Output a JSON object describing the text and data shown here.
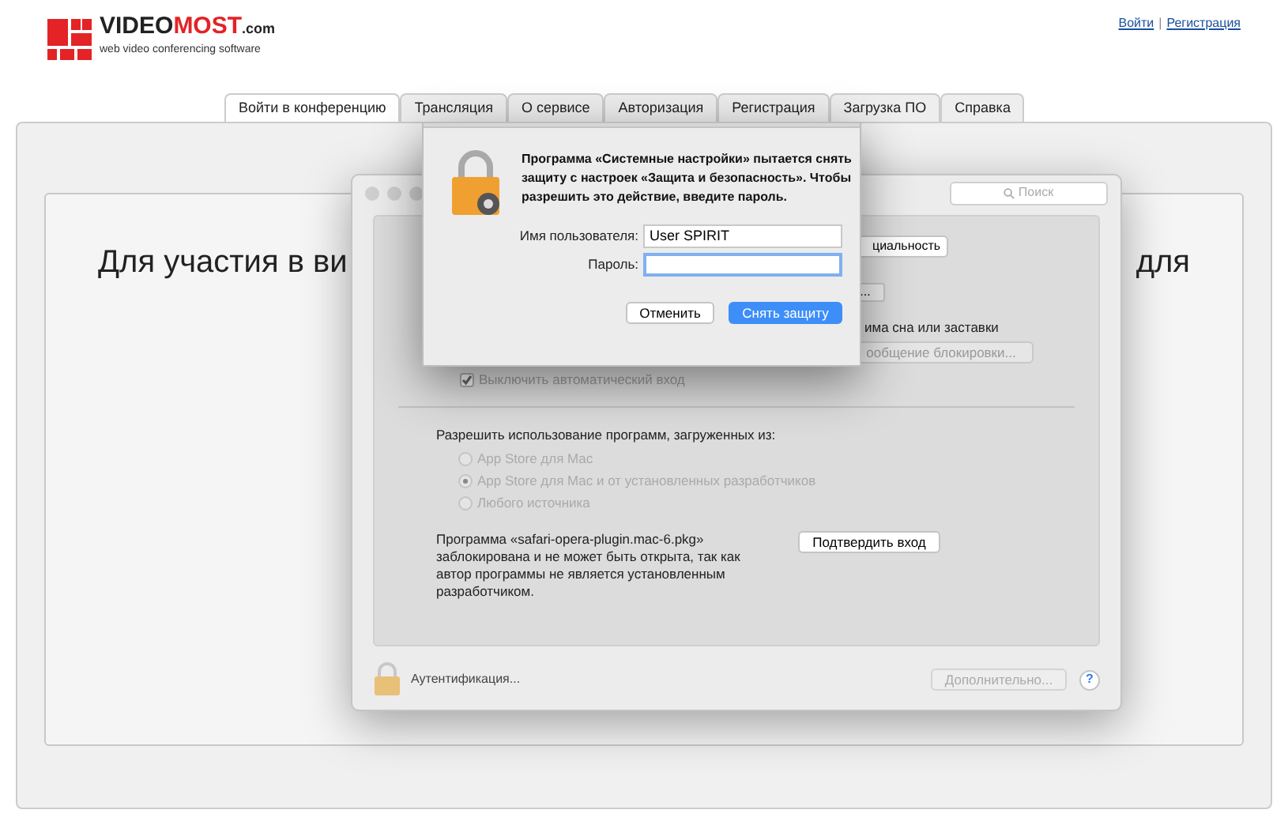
{
  "header": {
    "logo": {
      "brand_first": "VIDEO",
      "brand_second": "MOST",
      "brand_suffix": ".com",
      "tagline": "web video conferencing software"
    },
    "links": [
      "Войти",
      "Регистрация"
    ],
    "separator": "|"
  },
  "tabs": [
    {
      "label": "Войти в конференцию",
      "selected": true
    },
    {
      "label": "Трансляция",
      "selected": false
    },
    {
      "label": "О сервисе",
      "selected": false
    },
    {
      "label": "Авторизация",
      "selected": false
    },
    {
      "label": "Регистрация",
      "selected": false
    },
    {
      "label": "Загрузка ПО",
      "selected": false
    },
    {
      "label": "Справка",
      "selected": false
    }
  ],
  "page": {
    "heading_left": "Для участия в ви",
    "heading_right": "для"
  },
  "settings_window": {
    "search_placeholder": "Поиск",
    "partial_tab_button": "циальность",
    "partial_small_button": "...",
    "partial_label": "има сна или заставки",
    "partial_message_button": "ообщение блокировки...",
    "auto_login": {
      "label": "Выключить автоматический вход",
      "checked": true,
      "disabled": true
    },
    "allow_label": "Разрешить использование программ, загруженных из:",
    "sources": [
      {
        "label": "App Store для Mac",
        "selected": false,
        "disabled": true
      },
      {
        "label": "App Store для Mac и от установленных разработчиков",
        "selected": true,
        "disabled": true
      },
      {
        "label": "Любого источника",
        "selected": false,
        "disabled": true
      }
    ],
    "blocked_message": "Программа «safari-opera-plugin.mac-6.pkg» заблокирована и не может быть открыта, так как автор программы не является установленным разработчиком.",
    "confirm_button": "Подтвердить вход",
    "footer": {
      "auth_label": "Аутентификация...",
      "advanced_button": {
        "label": "Дополнительно...",
        "disabled": true
      },
      "help": "?"
    }
  },
  "dialog": {
    "message": "Программа «Системные настройки» пытается снять защиту с настроек «Защита и безопасность». Чтобы разрешить это действие, введите пароль.",
    "username_label": "Имя пользователя:",
    "username_value": "User SPIRIT",
    "password_label": "Пароль:",
    "password_focused": true,
    "cancel_button": "Отменить",
    "confirm_button": "Снять защиту"
  }
}
